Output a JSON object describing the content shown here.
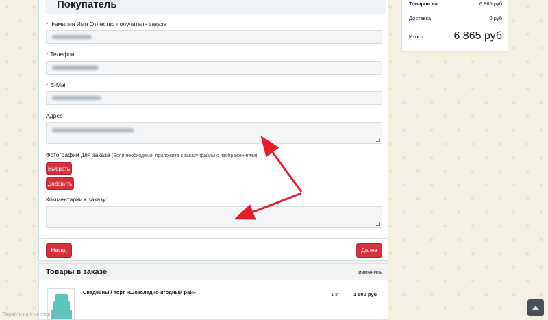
{
  "form": {
    "title": "Покупатель",
    "fio_label": "Фамилия Имя Отчество получателя заказа",
    "fio_required": "*",
    "phone_label": "Телефон",
    "phone_required": "*",
    "email_label": "E-Mail",
    "email_required": "*",
    "address_label": "Адрес",
    "photos_label": "Фотографии для заказа",
    "photos_hint": "(Если необходимо, приложите к заказу файлы с изображениями)",
    "choose_button": "Выбрать",
    "add_button": "Добавить",
    "comment_label": "Комментарии к заказу:",
    "back_button": "Назад",
    "next_button": "Далее"
  },
  "items": {
    "title": "Товары в заказе",
    "edit_link": "изменить",
    "rows": [
      {
        "name": "Свадебный торт «Шоколадно-ягодный рай»",
        "qty": "1 кг",
        "price": "1 500 руб"
      }
    ]
  },
  "summary": {
    "goods_label": "Товаров на:",
    "goods_value": "6 865 руб",
    "delivery_label": "Доставка:",
    "delivery_value": "0 руб",
    "total_label": "Итого:",
    "total_value": "6 865 руб"
  },
  "status_bar": "Перейти на # на этой странице",
  "colors": {
    "accent": "#d6313d",
    "arrow": "#e0202c",
    "scroll_top_bg": "#4a4f55"
  },
  "icons": {
    "scroll_top": "caret-up-icon"
  }
}
